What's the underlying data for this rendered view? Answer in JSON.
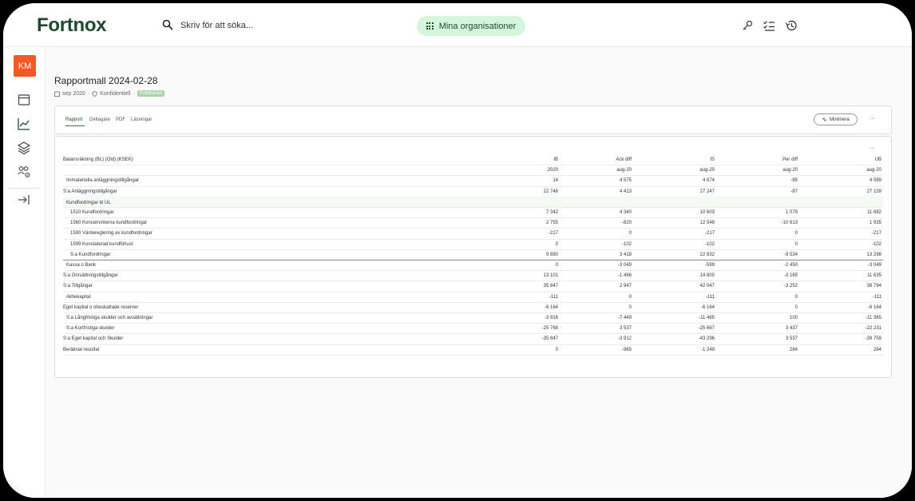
{
  "app": {
    "logo": "Fortnox"
  },
  "search": {
    "placeholder": "Skriv för att söka..."
  },
  "org_button": {
    "label": "Mina organisationer"
  },
  "user": {
    "initials": "KM"
  },
  "colors": {
    "accent": "#1d4a2c",
    "avatar": "#f15a24",
    "org_bg": "#d6f6dc",
    "badge": "#a5d6ae"
  },
  "report": {
    "title": "Rapportmall 2024-02-28",
    "period": "sep 2020",
    "confidentiality": "Konfidentiell",
    "status": "Publicerad"
  },
  "tabs": [
    {
      "label": "Rapport",
      "active": true
    },
    {
      "label": "Deltagare",
      "active": false
    },
    {
      "label": "PDF",
      "active": false
    },
    {
      "label": "Läsningar",
      "active": false
    }
  ],
  "minimize_label": "Minimera",
  "more_label": "...",
  "table": {
    "headers": [
      "Balansräkning (BL) (Old) (KSEK)",
      "IB",
      "Ack diff",
      "IS",
      "Per diff",
      "UB"
    ],
    "subheaders": [
      "",
      "2020",
      "aug-20",
      "aug-20",
      "aug-20",
      "aug-20"
    ],
    "rows": [
      {
        "label": "Immateriella anläggningstillgångar",
        "indent": 1,
        "values": [
          "14",
          "4 575",
          "4 674",
          "-85",
          "4 589"
        ]
      },
      {
        "label": "S:a Anläggningstillgångar",
        "indent": 0,
        "values": [
          "22 746",
          "4 413",
          "27 247",
          "-87",
          "27 159"
        ]
      },
      {
        "label": "Kundfordringar ⊟ UL",
        "indent": 1,
        "values": [
          "",
          "",
          "",
          "",
          ""
        ],
        "highlight": true
      },
      {
        "label": "1510 Kundfordringar",
        "indent": 2,
        "values": [
          "7 342",
          "4 340",
          "10 603",
          "1 079",
          "11 682"
        ]
      },
      {
        "label": "1560 Koncerninterna kundfordringar",
        "indent": 2,
        "values": [
          "2 755",
          "-820",
          "12 548",
          "-10 613",
          "1 935"
        ]
      },
      {
        "label": "1590 Värdereglering av kundfordringar",
        "indent": 2,
        "values": [
          "-217",
          "0",
          "-217",
          "0",
          "-217"
        ]
      },
      {
        "label": "1599 Konstaterad kundförlust",
        "indent": 2,
        "values": [
          "0",
          "-102",
          "-102",
          "0",
          "-102"
        ]
      },
      {
        "label": "S:a Kundfordringar",
        "indent": 2,
        "values": [
          "9 880",
          "3 418",
          "22 832",
          "-9 534",
          "13 298"
        ],
        "separator": true
      },
      {
        "label": "Kassa o Bank",
        "indent": 1,
        "values": [
          "0",
          "-3 049",
          "-599",
          "-2 450",
          "-3 049"
        ]
      },
      {
        "label": "S:a Omsättningstillgångar",
        "indent": 0,
        "values": [
          "13 101",
          "-1 466",
          "14 800",
          "-3 165",
          "11 635"
        ]
      },
      {
        "label": "S:a Tillgångar",
        "indent": 0,
        "values": [
          "35 847",
          "2 947",
          "42 047",
          "-3 252",
          "38 794"
        ]
      },
      {
        "label": "Aktiekapital",
        "indent": 1,
        "values": [
          "-111",
          "0",
          "-111",
          "0",
          "-111"
        ]
      },
      {
        "label": "Eget kapital o obeskattade reserver",
        "indent": 0,
        "values": [
          "-6 164",
          "0",
          "-6 164",
          "0",
          "-6 164"
        ]
      },
      {
        "label": "S:a Långfristiga skulder och avsättningar",
        "indent": 1,
        "values": [
          "-3 916",
          "-7 449",
          "-11 465",
          "100",
          "-11 365"
        ]
      },
      {
        "label": "S:a Kortfristiga skulder",
        "indent": 1,
        "values": [
          "-25 768",
          "3 537",
          "-25 667",
          "3 437",
          "-22 231"
        ]
      },
      {
        "label": "S:a Eget kapital och Skulder",
        "indent": 0,
        "values": [
          "-35 847",
          "-3 912",
          "-43 296",
          "3 537",
          "-39 759"
        ]
      },
      {
        "label": "Beräknat resultat",
        "indent": 0,
        "values": [
          "0",
          "-965",
          "-1 249",
          "284",
          "284"
        ]
      }
    ]
  }
}
